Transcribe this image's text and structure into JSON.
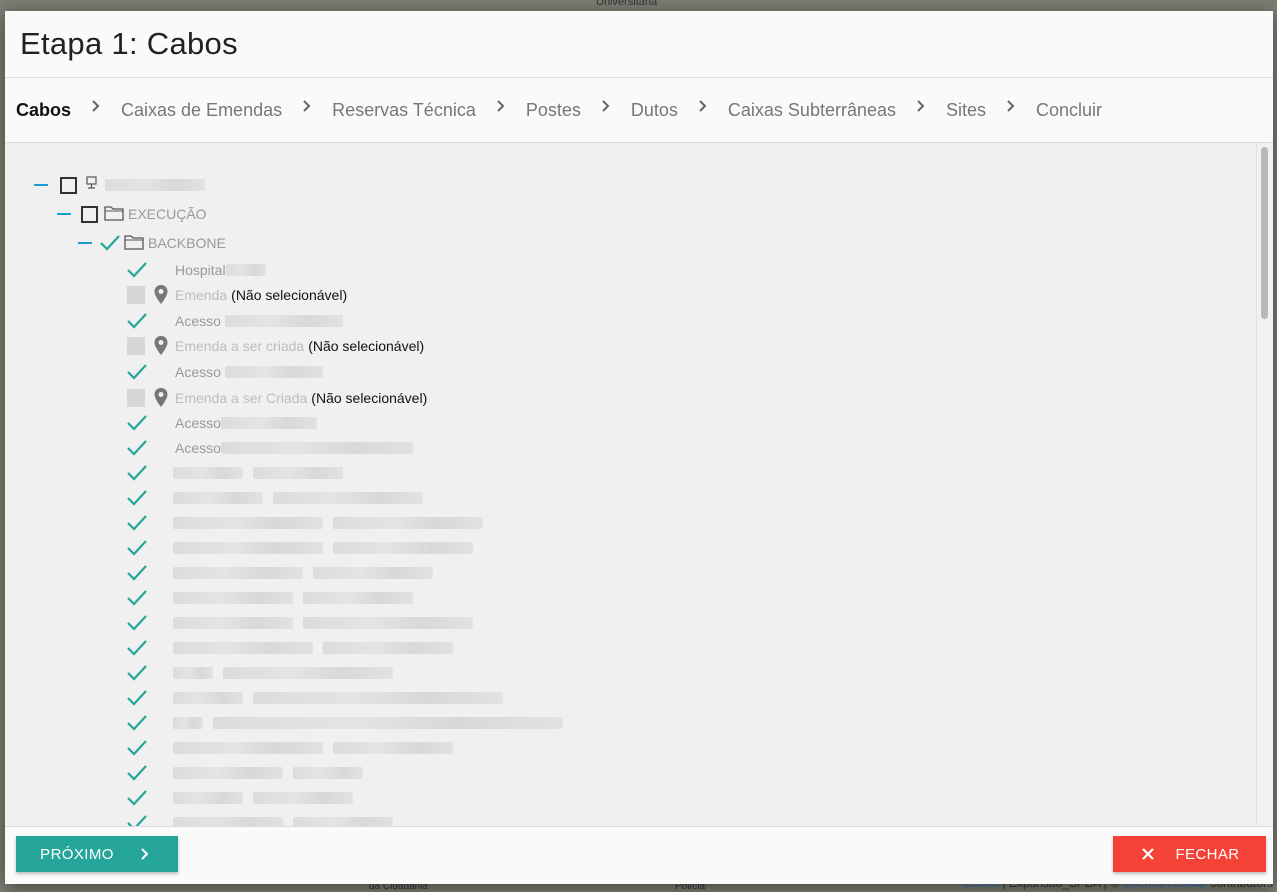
{
  "map": {
    "top_label": "Universitária",
    "bottom_label_left": "da Cidadania",
    "bottom_label_right": "Polícia",
    "attribution": {
      "leaflet": "Leaflet",
      "middle": " | Expansão_SPBA | © ",
      "osm": "OpenStreetMap",
      "tail": " contributors"
    }
  },
  "dialog": {
    "title": "Etapa 1: Cabos",
    "steps": [
      {
        "label": "Cabos",
        "active": true
      },
      {
        "label": "Caixas de Emendas",
        "active": false
      },
      {
        "label": "Reservas Técnica",
        "active": false
      },
      {
        "label": "Postes",
        "active": false
      },
      {
        "label": "Dutos",
        "active": false
      },
      {
        "label": "Caixas Subterrâneas",
        "active": false
      },
      {
        "label": "Sites",
        "active": false
      },
      {
        "label": "Concluir",
        "active": false
      }
    ],
    "tree": {
      "folder_execucao": "EXECUÇÃO",
      "folder_backbone": "BACKBONE",
      "items": [
        {
          "kind": "checked",
          "label": "Hospital"
        },
        {
          "kind": "disabled",
          "label": "Emenda",
          "suffix": "(Não selecionável)"
        },
        {
          "kind": "checked",
          "label": "Acesso"
        },
        {
          "kind": "disabled",
          "label": "Emenda a ser criada",
          "suffix": "(Não selecionável)"
        },
        {
          "kind": "checked",
          "label": "Acesso"
        },
        {
          "kind": "disabled",
          "label": "Emenda a ser Criada",
          "suffix": "(Não selecionável)"
        },
        {
          "kind": "checked",
          "label": "Acesso"
        },
        {
          "kind": "checked",
          "label": "Acesso"
        }
      ]
    },
    "buttons": {
      "next": "PRÓXIMO",
      "close": "FECHAR"
    },
    "colors": {
      "accent_teal": "#26a69a",
      "danger_red": "#f44336",
      "tree_dash_blue": "#1e9ad6"
    }
  }
}
